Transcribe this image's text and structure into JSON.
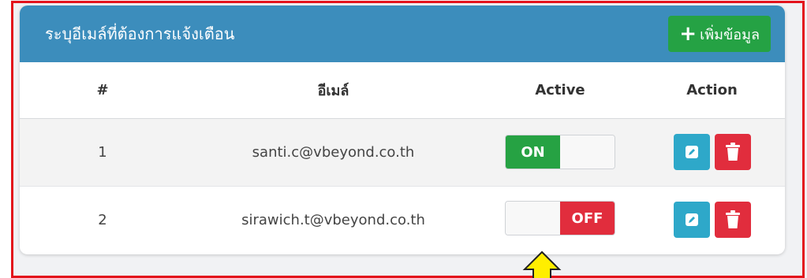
{
  "header": {
    "title": "ระบุอีเมล์ที่ต้องการแจ้งเตือน",
    "add_label": "เพิ่มข้อมูล"
  },
  "table": {
    "columns": [
      "#",
      "อีเมล์",
      "Active",
      "Action"
    ],
    "rows": [
      {
        "num": "1",
        "email": "santi.c@vbeyond.co.th",
        "active": "ON"
      },
      {
        "num": "2",
        "email": "sirawich.t@vbeyond.co.th",
        "active": "OFF"
      }
    ]
  },
  "colors": {
    "header_bg": "#3c8dbc",
    "add_button": "#25a244",
    "on": "#26a243",
    "off": "#e12d3d",
    "edit": "#2ea8c9",
    "delete": "#e12d3d",
    "highlight_frame": "#e3121b",
    "arrow": "#ffee00"
  },
  "icons": {
    "add": "plus-icon",
    "edit": "pencil-icon",
    "delete": "trash-icon",
    "pointer": "up-arrow-icon"
  }
}
